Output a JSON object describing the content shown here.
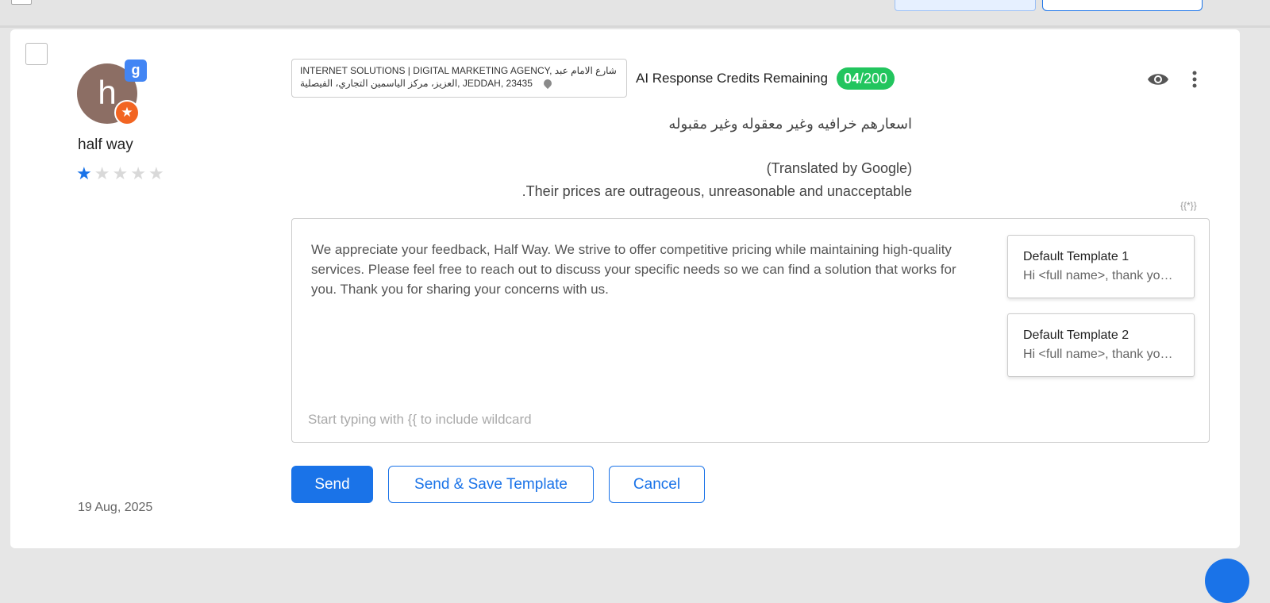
{
  "review": {
    "reviewer_name": "half way",
    "avatar_initial": "h",
    "source_badge": "g",
    "rating": 1,
    "max_rating": 5,
    "date": "19 Aug, 2025",
    "location_line1": "INTERNET SOLUTIONS | DIGITAL MARKETING AGENCY, شارع الامام عبد",
    "location_line2": "العزيز، مركز الياسمين التجاري، الفيصلية, JEDDAH, 23435",
    "original_text": "اسعارهم خرافيه وغير معقوله وغير مقبوله",
    "translated_note": "(Translated by Google)",
    "translated_text": ".Their prices are outrageous, unreasonable and unacceptable"
  },
  "credits": {
    "label": "AI Response Credits Remaining",
    "used": "04",
    "total": "/200"
  },
  "reply": {
    "text": "We appreciate your feedback, Half Way. We strive to offer competitive pricing while maintaining high-quality services. Please feel free to reach out to discuss your specific needs so we can find a solution that works for you. Thank you for sharing your concerns with us.",
    "placeholder": "Start typing with {{ to include wildcard",
    "wildcard_icon_text": "{{*}}"
  },
  "templates": [
    {
      "title": "Default Template 1",
      "preview": "Hi <full name>, thank you for your review"
    },
    {
      "title": "Default Template 2",
      "preview": "Hi <full name>, thank you for your review"
    }
  ],
  "actions": {
    "send": "Send",
    "send_save": "Send & Save Template",
    "cancel": "Cancel"
  },
  "colors": {
    "accent": "#1a73e8",
    "credits_green": "#22c55e",
    "avatar_bg": "#8c6e64",
    "google_blue": "#4285f4",
    "badge_orange": "#f26522"
  }
}
